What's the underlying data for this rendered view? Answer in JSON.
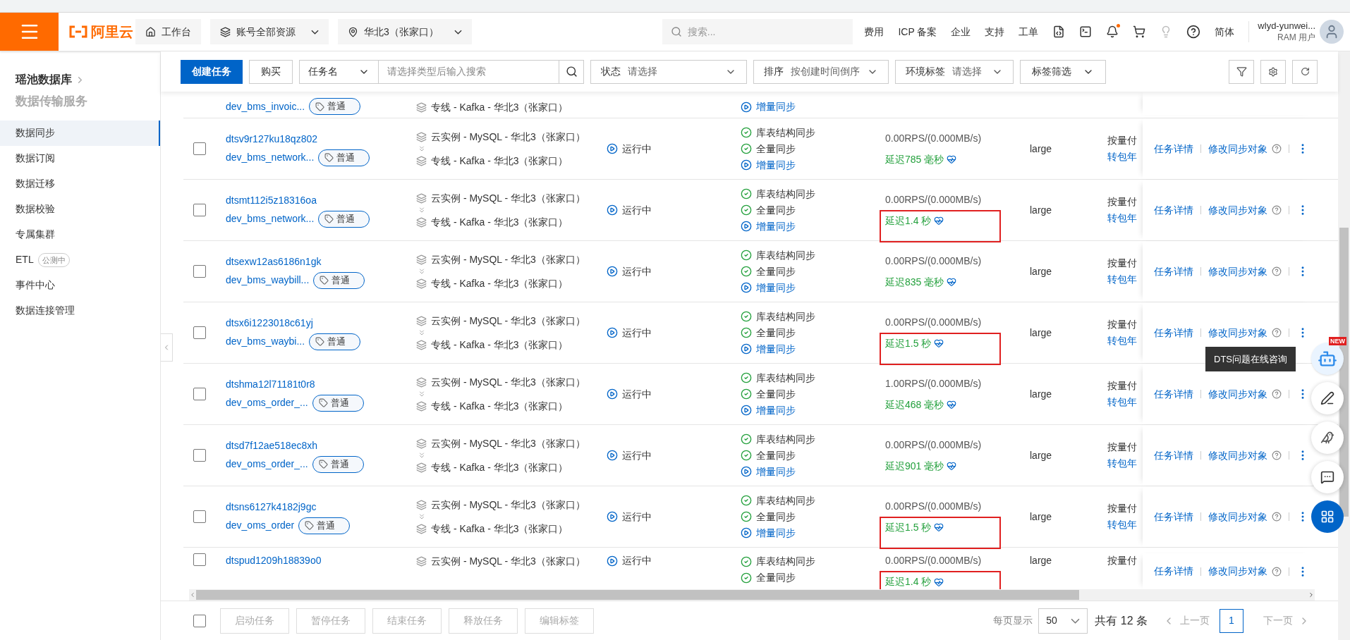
{
  "header": {
    "logo_text": "阿里云",
    "nav_buttons": [
      {
        "kind": "home",
        "label": "工作台",
        "dropdown": false
      },
      {
        "kind": "resources",
        "label": "账号全部资源",
        "dropdown": true
      },
      {
        "kind": "region",
        "label": "华北3（张家口）",
        "dropdown": true
      }
    ],
    "search_placeholder": "搜索...",
    "links": [
      "费用",
      "ICP 备案",
      "企业",
      "支持",
      "工单"
    ],
    "notifications_unread": true,
    "language": "简体",
    "user": {
      "name": "wlyd-yunwei...",
      "role": "RAM 用户"
    }
  },
  "sidebar": {
    "product": "瑶池数据库",
    "service": "数据传输服务",
    "items": [
      {
        "label": "数据同步",
        "selected": true
      },
      {
        "label": "数据订阅",
        "selected": false
      },
      {
        "label": "数据迁移",
        "selected": false
      },
      {
        "label": "数据校验",
        "selected": false
      },
      {
        "label": "专属集群",
        "selected": false
      },
      {
        "label": "ETL",
        "badge": "公测中",
        "selected": false
      },
      {
        "label": "事件中心",
        "selected": false
      },
      {
        "label": "数据连接管理",
        "selected": false
      }
    ]
  },
  "toolbar": {
    "create": "创建任务",
    "buy": "购买",
    "search_type": "任务名",
    "search_placeholder": "请选择类型后输入搜索",
    "filters": [
      {
        "label": "状态",
        "value": "请选择"
      },
      {
        "label": "排序",
        "value": "按创建时间倒序"
      },
      {
        "label": "环境标签",
        "value": "请选择"
      }
    ],
    "tag_filter": "标签筛选"
  },
  "rows": [
    {
      "kind": "top_cut",
      "name": "dev_bms_invoic...",
      "tag": "普通",
      "target": "专线 - Kafka - 华北3（张家口）",
      "steps": [
        {
          "kind": "running",
          "label": "增量同步"
        }
      ],
      "highlighted": false
    },
    {
      "kind": "full",
      "checked": false,
      "id": "dtsv9r127ku18qz802",
      "name": "dev_bms_network...",
      "tag": "普通",
      "source": "云实例 - MySQL - 华北3（张家口）",
      "target": "专线 - Kafka - 华北3（张家口）",
      "status": "运行中",
      "steps": [
        {
          "kind": "done",
          "label": "库表结构同步"
        },
        {
          "kind": "done",
          "label": "全量同步"
        },
        {
          "kind": "running",
          "label": "增量同步"
        }
      ],
      "rps": "0.00RPS/(0.000MB/s)",
      "delay": "延迟785 毫秒",
      "spec": "large",
      "billing": [
        "按量付",
        "转包年"
      ],
      "actions": [
        "任务详情",
        "修改同步对象"
      ],
      "highlighted": false
    },
    {
      "kind": "full",
      "checked": false,
      "id": "dtsmt112i5z18316oa",
      "name": "dev_bms_network...",
      "tag": "普通",
      "source": "云实例 - MySQL - 华北3（张家口）",
      "target": "专线 - Kafka - 华北3（张家口）",
      "status": "运行中",
      "steps": [
        {
          "kind": "done",
          "label": "库表结构同步"
        },
        {
          "kind": "done",
          "label": "全量同步"
        },
        {
          "kind": "running",
          "label": "增量同步"
        }
      ],
      "rps": "0.00RPS/(0.000MB/s)",
      "delay": "延迟1.4 秒",
      "spec": "large",
      "billing": [
        "按量付",
        "转包年"
      ],
      "actions": [
        "任务详情",
        "修改同步对象"
      ],
      "highlighted": true
    },
    {
      "kind": "full",
      "checked": false,
      "id": "dtsexw12as6186n1gk",
      "name": "dev_bms_waybill...",
      "tag": "普通",
      "source": "云实例 - MySQL - 华北3（张家口）",
      "target": "专线 - Kafka - 华北3（张家口）",
      "status": "运行中",
      "steps": [
        {
          "kind": "done",
          "label": "库表结构同步"
        },
        {
          "kind": "done",
          "label": "全量同步"
        },
        {
          "kind": "running",
          "label": "增量同步"
        }
      ],
      "rps": "0.00RPS/(0.000MB/s)",
      "delay": "延迟835 毫秒",
      "spec": "large",
      "billing": [
        "按量付",
        "转包年"
      ],
      "actions": [
        "任务详情",
        "修改同步对象"
      ],
      "highlighted": false
    },
    {
      "kind": "full",
      "checked": false,
      "id": "dtsx6i1223018c61yj",
      "name": "dev_bms_waybi...",
      "tag": "普通",
      "source": "云实例 - MySQL - 华北3（张家口）",
      "target": "专线 - Kafka - 华北3（张家口）",
      "status": "运行中",
      "steps": [
        {
          "kind": "done",
          "label": "库表结构同步"
        },
        {
          "kind": "done",
          "label": "全量同步"
        },
        {
          "kind": "running",
          "label": "增量同步"
        }
      ],
      "rps": "0.00RPS/(0.000MB/s)",
      "delay": "延迟1.5 秒",
      "spec": "large",
      "billing": [
        "按量付",
        "转包年"
      ],
      "actions": [
        "任务详情",
        "修改同步对象"
      ],
      "highlighted": true
    },
    {
      "kind": "full",
      "checked": false,
      "id": "dtshma12l71181t0r8",
      "name": "dev_oms_order_...",
      "tag": "普通",
      "source": "云实例 - MySQL - 华北3（张家口）",
      "target": "专线 - Kafka - 华北3（张家口）",
      "status": "运行中",
      "steps": [
        {
          "kind": "done",
          "label": "库表结构同步"
        },
        {
          "kind": "done",
          "label": "全量同步"
        },
        {
          "kind": "running",
          "label": "增量同步"
        }
      ],
      "rps": "1.00RPS/(0.000MB/s)",
      "delay": "延迟468 毫秒",
      "spec": "large",
      "billing": [
        "按量付",
        "转包年"
      ],
      "actions": [
        "任务详情",
        "修改同步对象"
      ],
      "highlighted": false
    },
    {
      "kind": "full",
      "checked": false,
      "id": "dtsd7f12ae518ec8xh",
      "name": "dev_oms_order_...",
      "tag": "普通",
      "source": "云实例 - MySQL - 华北3（张家口）",
      "target": "专线 - Kafka - 华北3（张家口）",
      "status": "运行中",
      "steps": [
        {
          "kind": "done",
          "label": "库表结构同步"
        },
        {
          "kind": "done",
          "label": "全量同步"
        },
        {
          "kind": "running",
          "label": "增量同步"
        }
      ],
      "rps": "0.00RPS/(0.000MB/s)",
      "delay": "延迟901 毫秒",
      "spec": "large",
      "billing": [
        "按量付",
        "转包年"
      ],
      "actions": [
        "任务详情",
        "修改同步对象"
      ],
      "highlighted": false
    },
    {
      "kind": "full",
      "checked": false,
      "id": "dtsns6127k4182j9gc",
      "name": "dev_oms_order",
      "tag": "普通",
      "source": "云实例 - MySQL - 华北3（张家口）",
      "target": "专线 - Kafka - 华北3（张家口）",
      "status": "运行中",
      "steps": [
        {
          "kind": "done",
          "label": "库表结构同步"
        },
        {
          "kind": "done",
          "label": "全量同步"
        },
        {
          "kind": "running",
          "label": "增量同步"
        }
      ],
      "rps": "0.00RPS/(0.000MB/s)",
      "delay": "延迟1.5 秒",
      "spec": "large",
      "billing": [
        "按量付",
        "转包年"
      ],
      "actions": [
        "任务详情",
        "修改同步对象"
      ],
      "highlighted": true
    },
    {
      "kind": "bottom_cut",
      "checked": false,
      "id": "dtspud1209h18839o0",
      "source": "云实例 - MySQL - 华北3（张家口）",
      "status": "运行中",
      "steps": [
        {
          "kind": "done",
          "label": "库表结构同步"
        },
        {
          "kind": "done",
          "label": "全量同步"
        }
      ],
      "rps": "0.00RPS/(0.000MB/s)",
      "delay": "延迟1.4 秒",
      "spec": "large",
      "billing": [
        "按量付"
      ],
      "actions": [
        "任务详情",
        "修改同步对象"
      ],
      "highlighted": true
    }
  ],
  "footer": {
    "select_all_checked": false,
    "batch_buttons": [
      {
        "label": "启动任务",
        "disabled": true
      },
      {
        "label": "暂停任务",
        "disabled": true
      },
      {
        "label": "结束任务",
        "disabled": true
      },
      {
        "label": "释放任务",
        "disabled": true
      },
      {
        "label": "编辑标签",
        "disabled": true
      }
    ],
    "page_size_label": "每页显示",
    "page_size": "50",
    "total": "共有 12 条",
    "prev": {
      "label": "上一页",
      "disabled": true
    },
    "pages": [
      {
        "label": "1",
        "selected": true
      }
    ],
    "next": {
      "label": "下一页",
      "disabled": true
    }
  },
  "assistant": {
    "badge": "NEW",
    "tooltip": "DTS问题在线咨询"
  }
}
